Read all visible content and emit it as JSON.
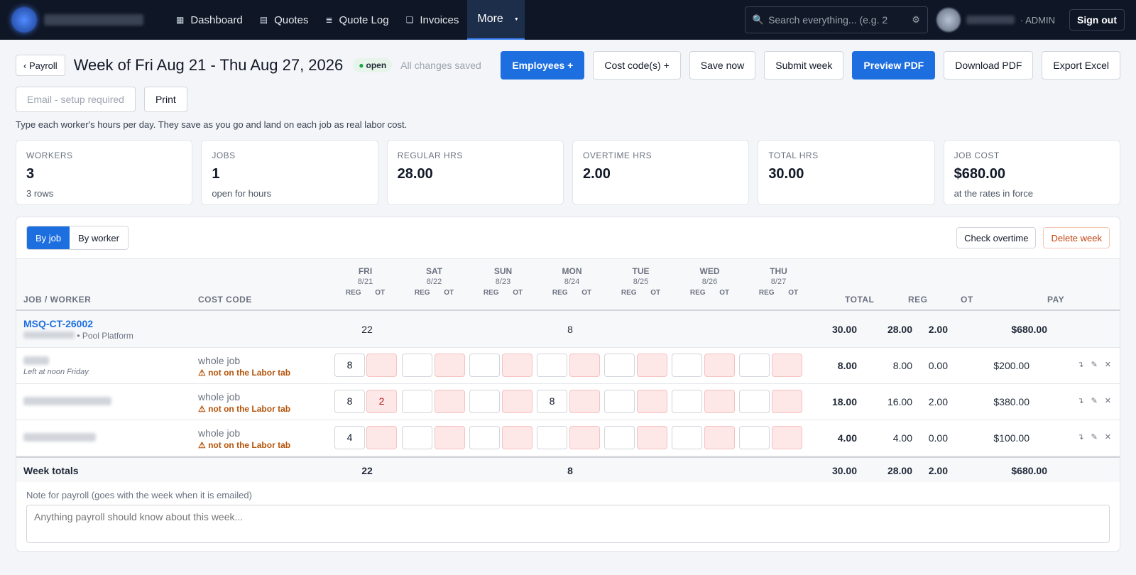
{
  "nav": {
    "links": [
      {
        "label": "Dashboard",
        "icon": "dashboard-icon"
      },
      {
        "label": "Quotes",
        "icon": "quotes-icon"
      },
      {
        "label": "Quote Log",
        "icon": "list-icon"
      },
      {
        "label": "Invoices",
        "icon": "invoices-icon"
      },
      {
        "label": "More",
        "icon": "chevron-down-icon"
      }
    ],
    "search_placeholder": "Search everything... (e.g. 2",
    "role": "· ADMIN",
    "signout": "Sign out"
  },
  "header": {
    "back": "‹ Payroll",
    "title": "Week of Fri Aug 21 - Thu Aug 27, 2026",
    "status": "open",
    "saved": "All changes saved",
    "actions": {
      "employees": "Employees +",
      "cost_codes": "Cost code(s) +",
      "save_now": "Save now",
      "submit": "Submit week",
      "preview": "Preview PDF",
      "download": "Download PDF",
      "export": "Export Excel"
    },
    "email": "Email - setup required",
    "print": "Print",
    "help": "Type each worker's hours per day. They save as you go and land on each job as real labor cost."
  },
  "stats": [
    {
      "label": "WORKERS",
      "value": "3",
      "sub": "3 rows"
    },
    {
      "label": "JOBS",
      "value": "1",
      "sub": "open for hours"
    },
    {
      "label": "REGULAR HRS",
      "value": "28.00",
      "sub": ""
    },
    {
      "label": "OVERTIME HRS",
      "value": "2.00",
      "sub": ""
    },
    {
      "label": "TOTAL HRS",
      "value": "30.00",
      "sub": ""
    },
    {
      "label": "JOB COST",
      "value": "$680.00",
      "sub": "at the rates in force"
    }
  ],
  "toolbar": {
    "by_job": "By job",
    "by_worker": "By worker",
    "check_overtime": "Check overtime",
    "delete_week": "Delete week"
  },
  "table": {
    "col_job": "JOB / WORKER",
    "col_cost": "COST CODE",
    "col_total": "TOTAL",
    "col_reg": "REG",
    "col_ot": "OT",
    "col_pay": "PAY",
    "reg": "REG",
    "ot": "OT",
    "days": [
      {
        "name": "FRI",
        "date": "8/21"
      },
      {
        "name": "SAT",
        "date": "8/22"
      },
      {
        "name": "SUN",
        "date": "8/23"
      },
      {
        "name": "MON",
        "date": "8/24"
      },
      {
        "name": "TUE",
        "date": "8/25"
      },
      {
        "name": "WED",
        "date": "8/26"
      },
      {
        "name": "THU",
        "date": "8/27"
      }
    ],
    "job": {
      "code": "MSQ-CT-26002",
      "desc": "• Pool Platform",
      "fri": "22",
      "mon": "8",
      "total": "30.00",
      "reg": "28.00",
      "ot": "2.00",
      "pay": "$680.00"
    },
    "workers": [
      {
        "note": "Left at noon Friday",
        "cost": "whole job",
        "warn": "⚠ not on the Labor tab",
        "fri_reg": "8",
        "fri_ot": "",
        "mon_reg": "",
        "total": "8.00",
        "reg": "8.00",
        "ot": "0.00",
        "pay": "$200.00"
      },
      {
        "note": "",
        "cost": "whole job",
        "warn": "⚠ not on the Labor tab",
        "fri_reg": "8",
        "fri_ot": "2",
        "mon_reg": "8",
        "total": "18.00",
        "reg": "16.00",
        "ot": "2.00",
        "pay": "$380.00"
      },
      {
        "note": "",
        "cost": "whole job",
        "warn": "⚠ not on the Labor tab",
        "fri_reg": "4",
        "fri_ot": "",
        "mon_reg": "",
        "total": "4.00",
        "reg": "4.00",
        "ot": "0.00",
        "pay": "$100.00"
      }
    ],
    "totals": {
      "label": "Week totals",
      "fri": "22",
      "mon": "8",
      "total": "30.00",
      "reg": "28.00",
      "ot": "2.00",
      "pay": "$680.00"
    }
  },
  "note": {
    "label": "Note for payroll (goes with the week when it is emailed)",
    "placeholder": "Anything payroll should know about this week..."
  }
}
